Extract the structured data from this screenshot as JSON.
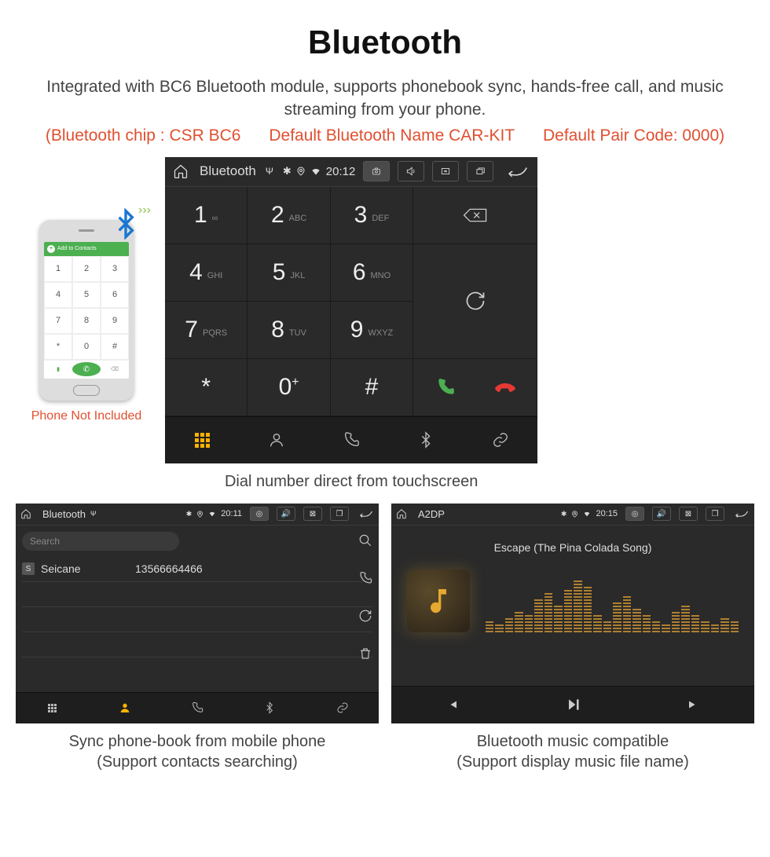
{
  "header": {
    "title": "Bluetooth",
    "subtitle": "Integrated with BC6 Bluetooth module, supports phonebook sync, hands-free call, and music streaming from your phone.",
    "specs": {
      "chip": "(Bluetooth chip : CSR BC6",
      "name": "Default Bluetooth Name CAR-KIT",
      "code": "Default Pair Code: 0000)"
    }
  },
  "phone": {
    "add_contacts": "Add to Contacts",
    "note": "Phone Not Included"
  },
  "dialer": {
    "status": {
      "title": "Bluetooth",
      "time": "20:12"
    },
    "keys": [
      {
        "n": "1",
        "s": "∞"
      },
      {
        "n": "2",
        "s": "ABC"
      },
      {
        "n": "3",
        "s": "DEF"
      },
      {
        "n": "4",
        "s": "GHI"
      },
      {
        "n": "5",
        "s": "JKL"
      },
      {
        "n": "6",
        "s": "MNO"
      },
      {
        "n": "7",
        "s": "PQRS"
      },
      {
        "n": "8",
        "s": "TUV"
      },
      {
        "n": "9",
        "s": "WXYZ"
      },
      {
        "n": "*",
        "s": ""
      },
      {
        "n": "0",
        "s": "+",
        "sup": true
      },
      {
        "n": "#",
        "s": ""
      }
    ],
    "caption": "Dial number direct from touchscreen"
  },
  "phonebook": {
    "status": {
      "title": "Bluetooth",
      "time": "20:11"
    },
    "search_placeholder": "Search",
    "contact": {
      "badge": "S",
      "name": "Seicane",
      "number": "13566664466"
    },
    "caption_l1": "Sync phone-book from mobile phone",
    "caption_l2": "(Support contacts searching)"
  },
  "a2dp": {
    "status": {
      "title": "A2DP",
      "time": "20:15"
    },
    "track": "Escape (The Pina Colada Song)",
    "caption_l1": "Bluetooth music compatible",
    "caption_l2": "(Support display music file name)"
  }
}
